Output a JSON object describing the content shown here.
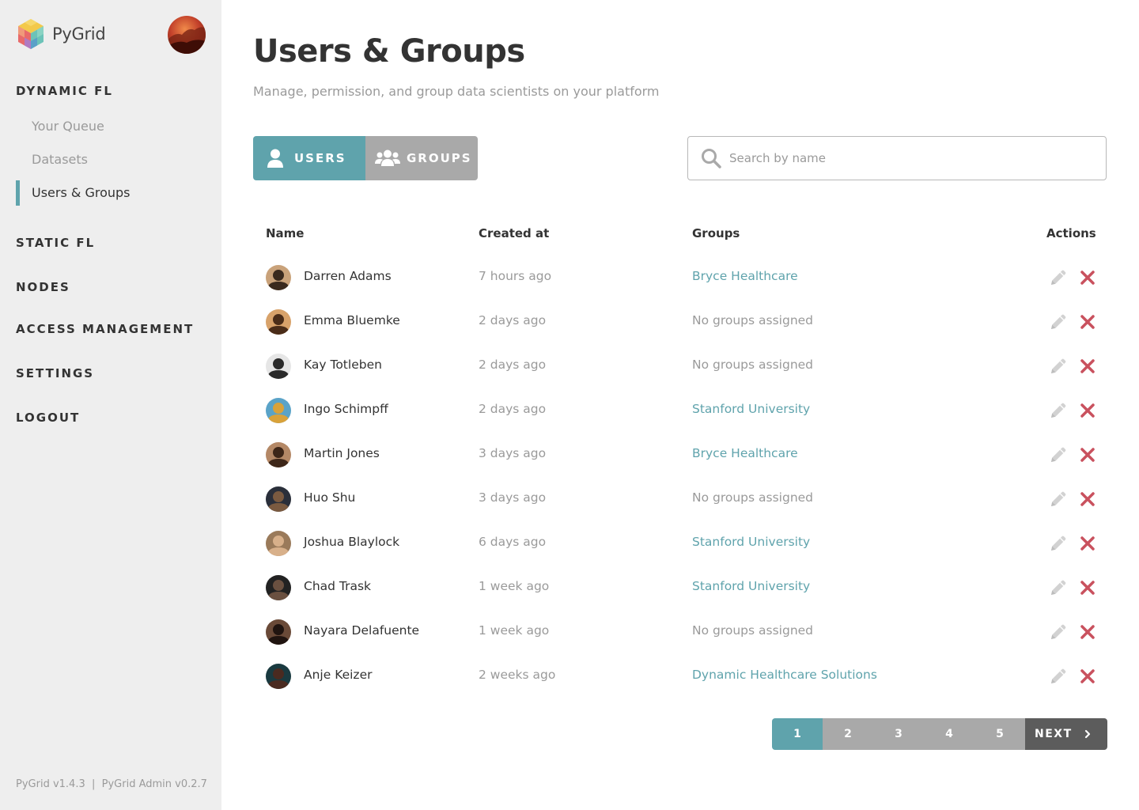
{
  "brand": {
    "name": "PyGrid"
  },
  "sidebar": {
    "sections": [
      {
        "label": "DYNAMIC FL"
      },
      {
        "label": "STATIC FL"
      },
      {
        "label": "NODES"
      },
      {
        "label": "ACCESS MANAGEMENT"
      },
      {
        "label": "SETTINGS"
      },
      {
        "label": "LOGOUT"
      }
    ],
    "sub_items": [
      {
        "label": "Your Queue"
      },
      {
        "label": "Datasets"
      },
      {
        "label": "Users & Groups",
        "active": true
      }
    ],
    "version": "PyGrid v1.4.3  |  PyGrid Admin v0.2.7"
  },
  "header": {
    "title": "Users & Groups",
    "subtitle": "Manage, permission, and group data scientists on your platform"
  },
  "toggle": {
    "users_label": "USERS",
    "groups_label": "GROUPS",
    "selected": "USERS"
  },
  "search": {
    "placeholder": "Search by name",
    "value": ""
  },
  "table": {
    "columns": {
      "name": "Name",
      "created": "Created at",
      "groups": "Groups",
      "actions": "Actions"
    },
    "rows": [
      {
        "name": "Darren Adams",
        "created": "7 hours ago",
        "group": "Bryce Healthcare"
      },
      {
        "name": "Emma Bluemke",
        "created": "2 days ago",
        "group": "No groups assigned"
      },
      {
        "name": "Kay Totleben",
        "created": "2 days ago",
        "group": "No groups assigned"
      },
      {
        "name": "Ingo Schimpff",
        "created": "2 days ago",
        "group": "Stanford University"
      },
      {
        "name": "Martin Jones",
        "created": "3 days ago",
        "group": "Bryce Healthcare"
      },
      {
        "name": "Huo Shu",
        "created": "3 days ago",
        "group": "No groups assigned"
      },
      {
        "name": "Joshua Blaylock",
        "created": "6 days ago",
        "group": "Stanford University"
      },
      {
        "name": "Chad Trask",
        "created": "1 week ago",
        "group": "Stanford University"
      },
      {
        "name": "Nayara Delafuente",
        "created": "1 week ago",
        "group": "No groups assigned"
      },
      {
        "name": "Anje Keizer",
        "created": "2 weeks ago",
        "group": "Dynamic Healthcare Solutions"
      }
    ]
  },
  "pagination": {
    "pages": [
      "1",
      "2",
      "3",
      "4",
      "5"
    ],
    "current": "1",
    "next_label": "NEXT"
  },
  "colors": {
    "accent": "#5fa3ac",
    "muted": "#a9a9a9",
    "delete": "#c9515e",
    "dark": "#5c5c5c"
  }
}
